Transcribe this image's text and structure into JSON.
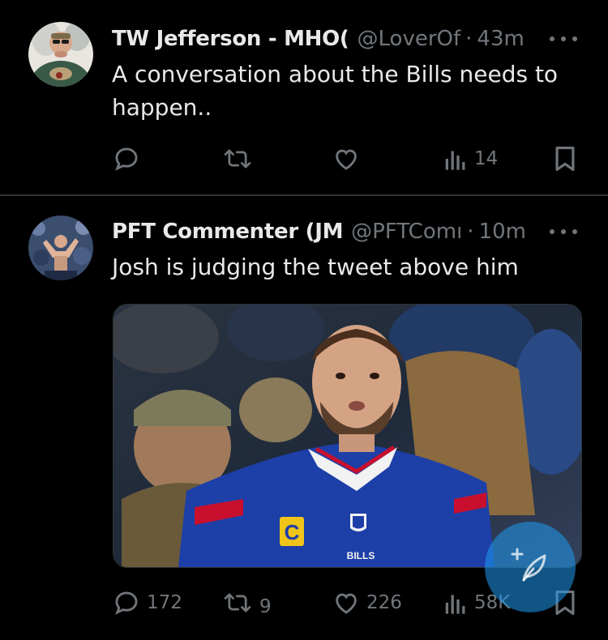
{
  "tweets": [
    {
      "display_name": "TW Jefferson - MHO(",
      "handle": "@LoverOf",
      "separator": "·",
      "time": "43m",
      "text": "A conversation about the Bills needs to happen..",
      "actions": {
        "replies": "",
        "retweets": "",
        "likes": "",
        "views": "14"
      }
    },
    {
      "display_name": "PFT Commenter (JM",
      "handle": "@PFTComı",
      "separator": "·",
      "time": "10m",
      "text": "Josh is judging the tweet above him",
      "media": {
        "jersey_label": "BILLS",
        "patch_letter": "C"
      },
      "actions": {
        "replies": "172",
        "retweets": "9",
        "likes": "226",
        "views": "58K"
      }
    }
  ],
  "colors": {
    "background": "#000000",
    "primary_text": "#e7e9ea",
    "secondary_text": "#71767b",
    "divider": "#2f3336",
    "accent": "#1d9bf0"
  },
  "icons": [
    "reply-icon",
    "retweet-icon",
    "like-icon",
    "views-icon",
    "bookmark-icon",
    "more-icon",
    "compose-icon"
  ]
}
